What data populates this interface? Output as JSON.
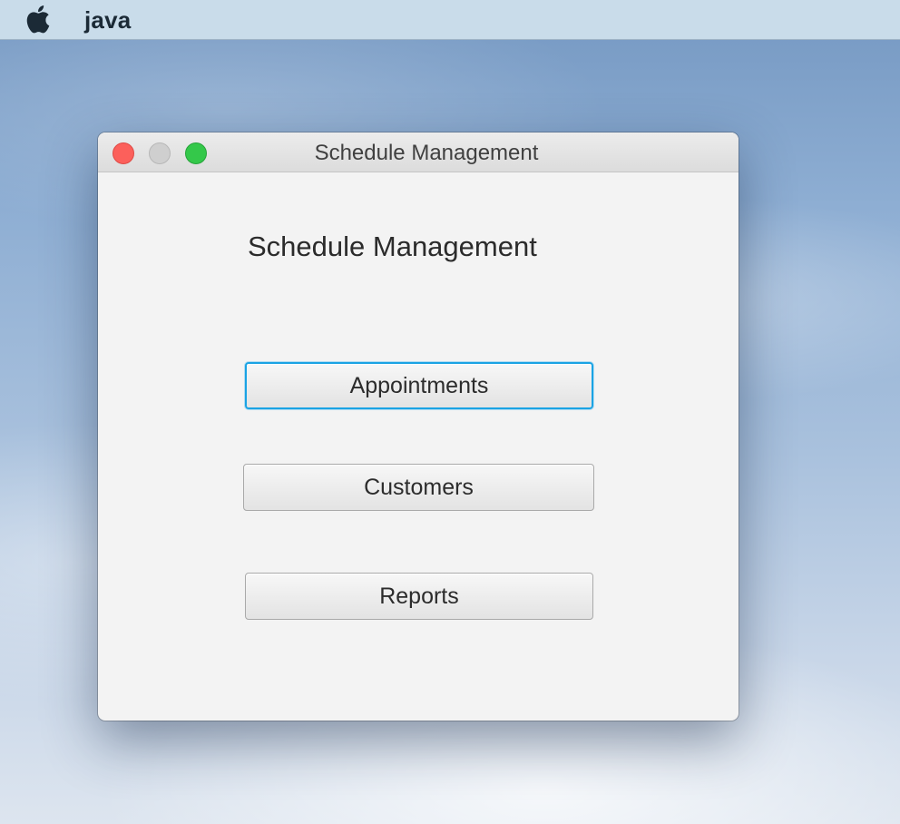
{
  "menubar": {
    "logo_icon": "apple-icon",
    "app_name": "java"
  },
  "window": {
    "title": "Schedule Management",
    "controls": [
      "close",
      "minimize",
      "zoom"
    ],
    "heading": "Schedule Management",
    "buttons": [
      {
        "label": "Appointments",
        "focused": true
      },
      {
        "label": "Customers",
        "focused": false
      },
      {
        "label": "Reports",
        "focused": false
      }
    ]
  },
  "colors": {
    "close": "#fc605b",
    "minimize": "#cfcfcf",
    "zoom": "#34c84a",
    "focus_ring": "#1aa3e4"
  }
}
